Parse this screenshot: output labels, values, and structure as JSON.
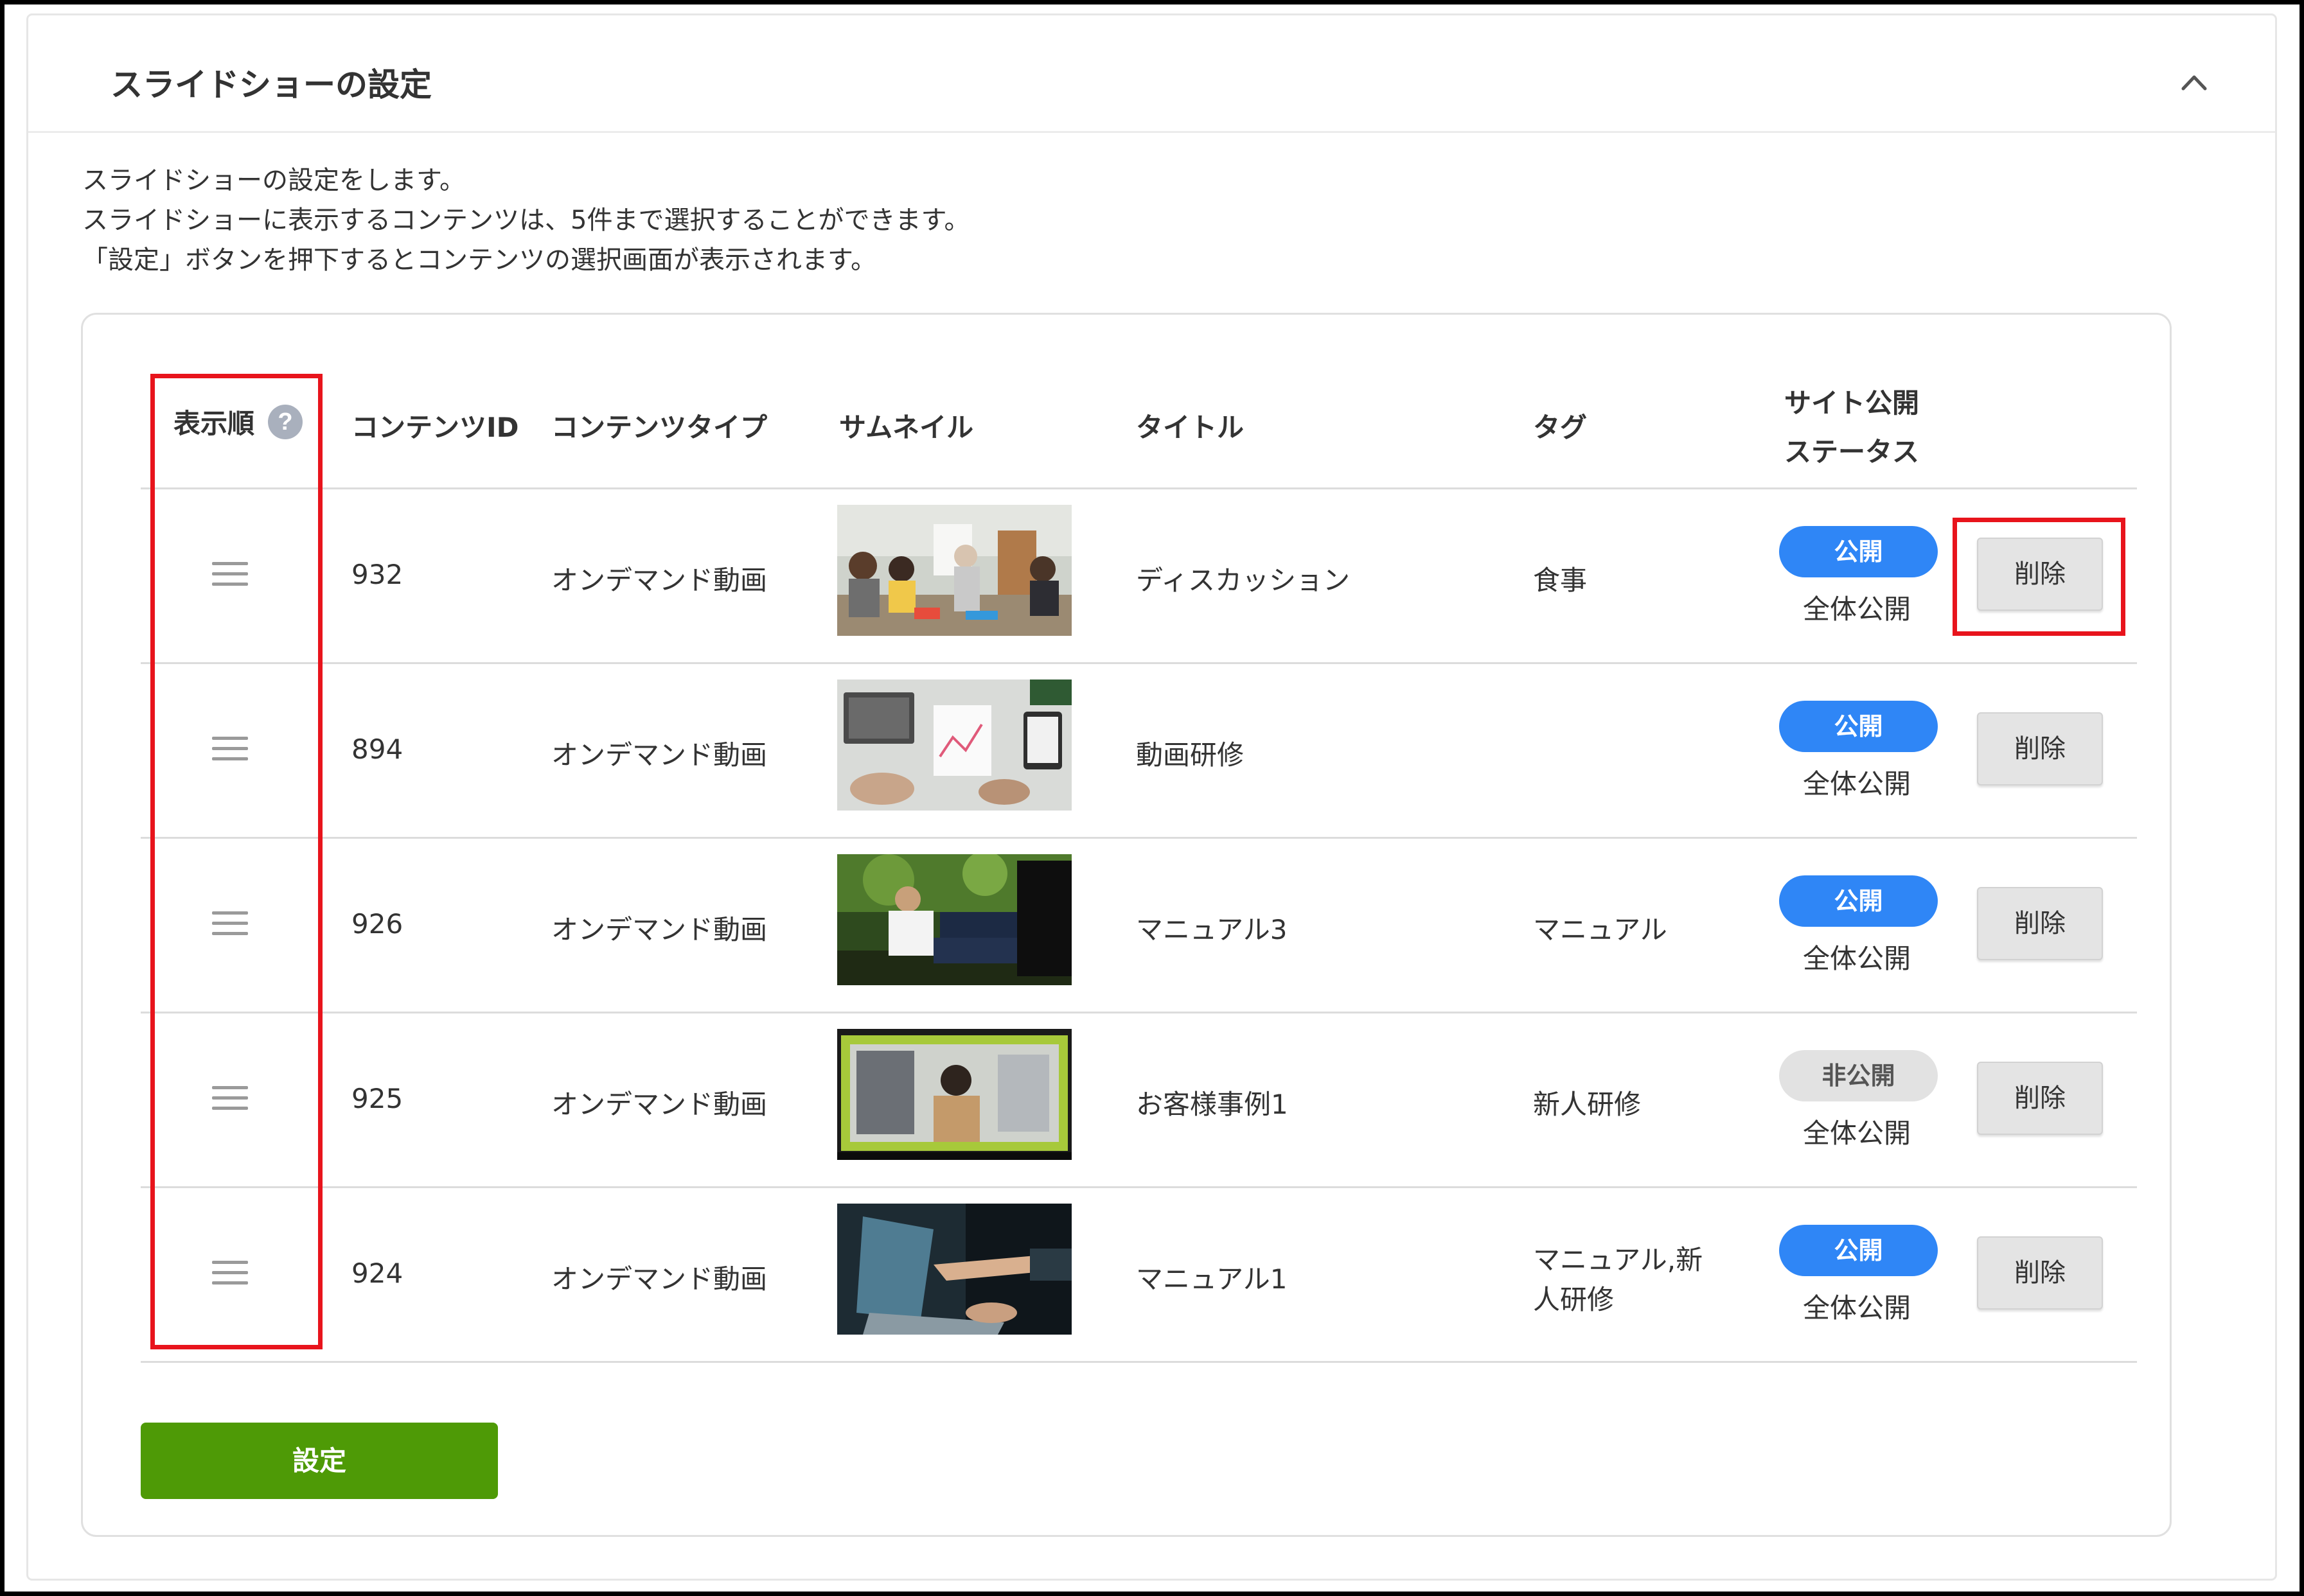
{
  "panel": {
    "title": "スライドショーの設定",
    "description": [
      "スライドショーの設定をします。",
      "スライドショーに表示するコンテンツは、5件まで選択することができます。",
      "「設定」ボタンを押下するとコンテンツの選択画面が表示されます。"
    ],
    "collapse_icon": "chevron-up-icon"
  },
  "table": {
    "headers": {
      "order": "表示順",
      "content_id": "コンテンツID",
      "content_type": "コンテンツタイプ",
      "thumbnail": "サムネイル",
      "title": "タイトル",
      "tag": "タグ",
      "status_line1": "サイト公開",
      "status_line2": "ステータス"
    },
    "help_icon": "question-circle-icon",
    "rows": [
      {
        "id": "932",
        "type": "オンデマンド動画",
        "thumbnail": "meeting-discussion-photo",
        "title": "ディスカッション",
        "tag_line1": "食事",
        "tag_line2": "",
        "status": "公開",
        "status_kind": "public",
        "scope": "全体公開",
        "delete_label": "削除"
      },
      {
        "id": "894",
        "type": "オンデマンド動画",
        "thumbnail": "desk-laptops-photo",
        "title": "動画研修",
        "tag_line1": "",
        "tag_line2": "",
        "status": "公開",
        "status_kind": "public",
        "scope": "全体公開",
        "delete_label": "削除"
      },
      {
        "id": "926",
        "type": "オンデマンド動画",
        "thumbnail": "business-people-outdoor-photo",
        "title": "マニュアル3",
        "tag_line1": "マニュアル",
        "tag_line2": "",
        "status": "公開",
        "status_kind": "public",
        "scope": "全体公開",
        "delete_label": "削除"
      },
      {
        "id": "925",
        "type": "オンデマンド動画",
        "thumbnail": "call-center-video-photo",
        "title": "お客様事例1",
        "tag_line1": "新人研修",
        "tag_line2": "",
        "status": "非公開",
        "status_kind": "private",
        "scope": "全体公開",
        "delete_label": "削除"
      },
      {
        "id": "924",
        "type": "オンデマンド動画",
        "thumbnail": "laptop-pointing-photo",
        "title": "マニュアル1",
        "tag_line1": "マニュアル,新",
        "tag_line2": "人研修",
        "status": "公開",
        "status_kind": "public",
        "scope": "全体公開",
        "delete_label": "削除"
      }
    ]
  },
  "actions": {
    "set_label": "設定"
  },
  "colors": {
    "public_pill": "#2f86f6",
    "private_pill": "#e2e2e2",
    "set_button": "#4e9a06",
    "highlight": "#e8141c"
  }
}
